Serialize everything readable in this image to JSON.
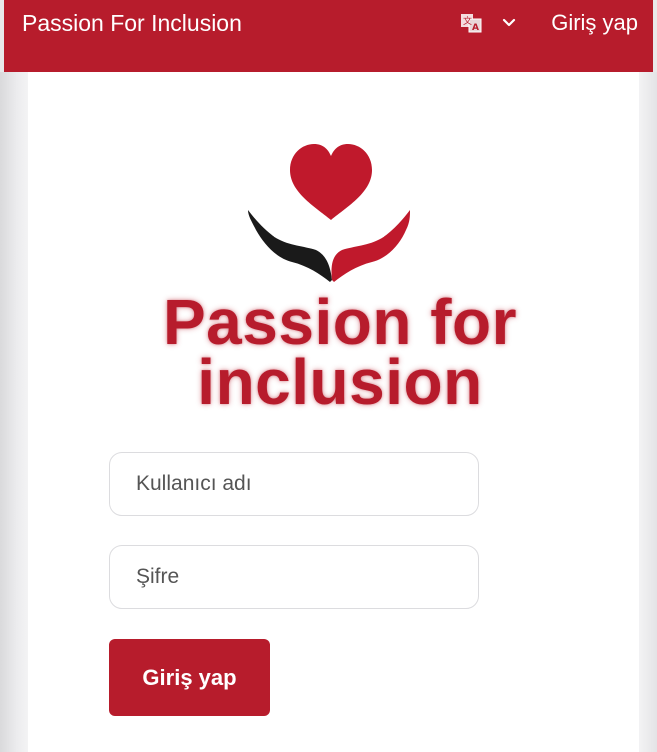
{
  "header": {
    "brand": "Passion For Inclusion",
    "language_icon": "translate-icon",
    "language_chevron_icon": "chevron-down-icon",
    "login_link": "Giriş yap",
    "background_color": "#b71c2c"
  },
  "logo": {
    "heart_icon": "heart-icon",
    "hands_icon": "hands-icon",
    "line1": "Passion for",
    "line2": "inclusion",
    "accent_color": "#b71c2c"
  },
  "form": {
    "username_placeholder": "Kullanıcı adı",
    "password_placeholder": "Şifre",
    "submit_label": "Giriş yap"
  }
}
